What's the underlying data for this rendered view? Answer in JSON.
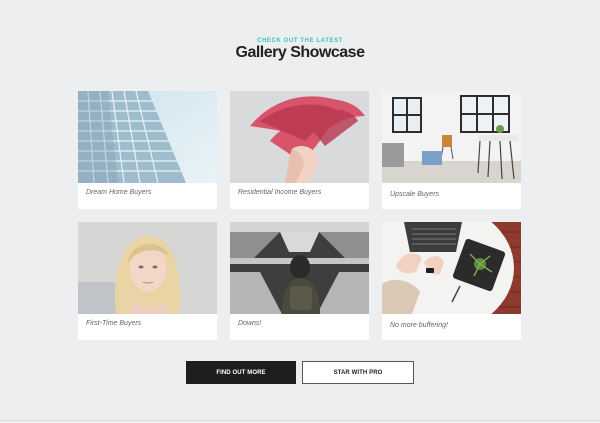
{
  "header": {
    "eyebrow": "CHECK OUT THE LATEST",
    "title": "Gallery Showcase"
  },
  "gallery": {
    "items": [
      {
        "caption": "Dream Home Buyers"
      },
      {
        "caption": "Residential Income Buyers"
      },
      {
        "caption": "Upscale Buyers"
      },
      {
        "caption": "First-Time Buyers"
      },
      {
        "caption": "Downs!"
      },
      {
        "caption": "No more buffering!"
      }
    ]
  },
  "buttons": {
    "primary_label": "FIND OUT MORE",
    "secondary_label": "STAR WITH PRO"
  },
  "colors": {
    "accent": "#3cc3b0",
    "page_bg": "#eceeef",
    "primary_button": "#1e1e1e"
  }
}
